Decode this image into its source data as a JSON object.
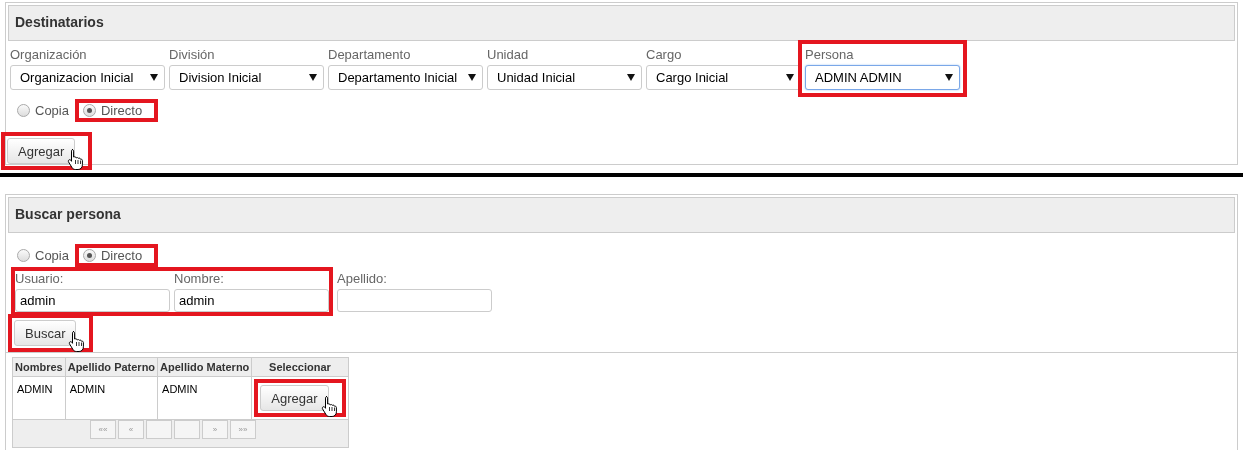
{
  "destinatarios": {
    "title": "Destinatarios",
    "selects": [
      {
        "label": "Organización",
        "value": "Organizacion Inicial",
        "focused": false,
        "highlighted": false
      },
      {
        "label": "División",
        "value": "Division Inicial",
        "focused": false,
        "highlighted": false
      },
      {
        "label": "Departamento",
        "value": "Departamento Inicial",
        "focused": false,
        "highlighted": false
      },
      {
        "label": "Unidad",
        "value": "Unidad Inicial",
        "focused": false,
        "highlighted": false
      },
      {
        "label": "Cargo",
        "value": "Cargo Inicial",
        "focused": false,
        "highlighted": false
      },
      {
        "label": "Persona",
        "value": "ADMIN ADMIN",
        "focused": true,
        "highlighted": true
      }
    ],
    "radios": [
      {
        "label": "Copia",
        "selected": false,
        "highlighted": false
      },
      {
        "label": "Directo",
        "selected": true,
        "highlighted": true
      }
    ],
    "button": {
      "label": "Agregar",
      "hovered": true,
      "highlighted": true
    }
  },
  "buscar_persona": {
    "title": "Buscar persona",
    "radios": [
      {
        "label": "Copia",
        "selected": false,
        "highlighted": false
      },
      {
        "label": "Directo",
        "selected": true,
        "highlighted": true
      }
    ],
    "fields": [
      {
        "label": "Usuario:",
        "value": "admin",
        "highlighted": true
      },
      {
        "label": "Nombre:",
        "value": "admin",
        "highlighted": true
      },
      {
        "label": "Apellido:",
        "highlighted": false
      }
    ],
    "button": {
      "label": "Buscar",
      "hovered": true,
      "highlighted": true
    },
    "table": {
      "columns": [
        "Nombres",
        "Apellido Paterno",
        "Apellido Materno",
        "Seleccionar"
      ],
      "rows": [
        {
          "cells": [
            "ADMIN",
            "ADMIN",
            "ADMIN"
          ],
          "button": {
            "label": "Agregar",
            "hovered": true,
            "highlighted": true
          }
        }
      ],
      "pager": [
        {
          "kind": "nav",
          "label": "««"
        },
        {
          "kind": "nav",
          "label": "«"
        },
        {
          "kind": "page"
        },
        {
          "kind": "page"
        },
        {
          "kind": "nav",
          "label": "»"
        },
        {
          "kind": "nav",
          "label": "»»"
        }
      ]
    }
  }
}
